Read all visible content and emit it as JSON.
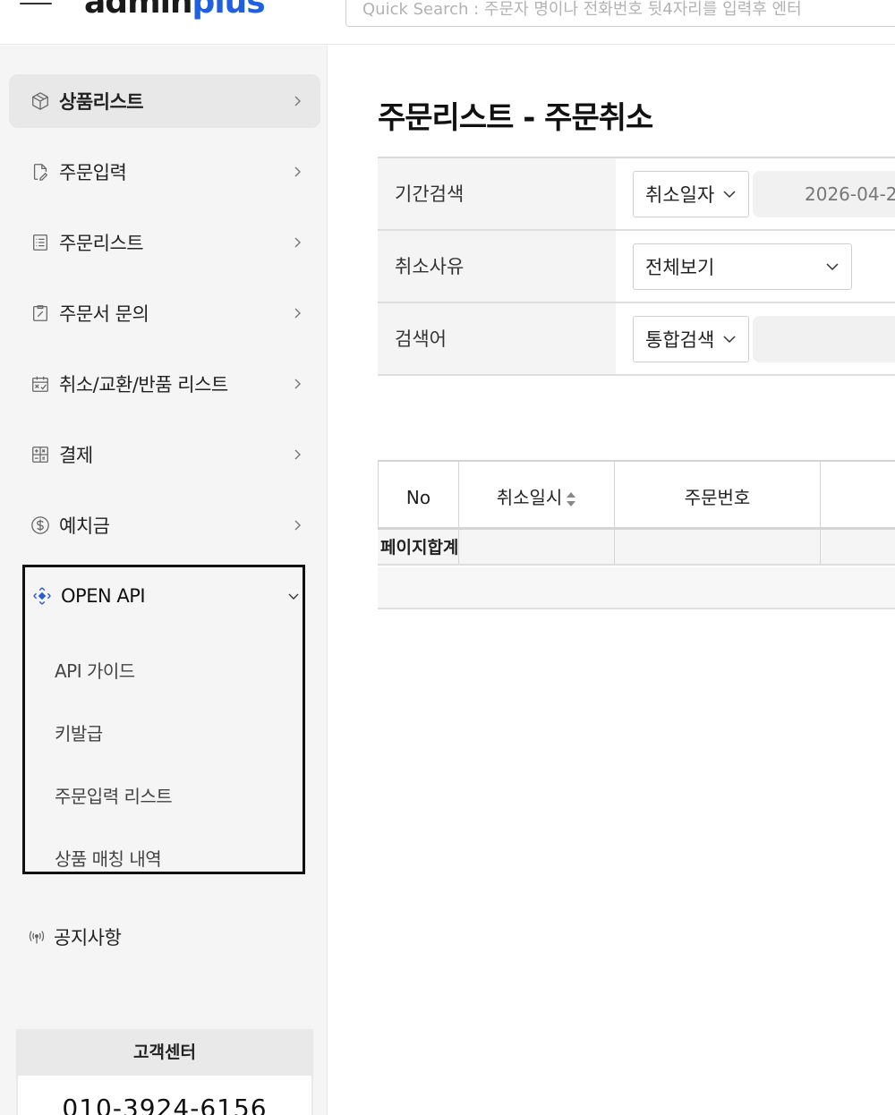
{
  "header": {
    "logo_main": "admin",
    "logo_accent": "plus",
    "search_placeholder": "Quick Search : 주문자 명이나 전화번호 뒷4자리를 입력후 엔터"
  },
  "sidebar": {
    "items": [
      {
        "label": "상품리스트",
        "icon": "box-icon",
        "active": true
      },
      {
        "label": "주문입력",
        "icon": "edit-document-icon"
      },
      {
        "label": "주문리스트",
        "icon": "list-icon"
      },
      {
        "label": "주문서 문의",
        "icon": "clipboard-edit-icon"
      },
      {
        "label": "취소/교환/반품 리스트",
        "icon": "calendar-cancel-icon"
      },
      {
        "label": "결제",
        "icon": "calculator-icon"
      },
      {
        "label": "예치금",
        "icon": "dollar-icon"
      }
    ],
    "open_api": {
      "label": "OPEN API",
      "icon": "api-icon",
      "sub_items": [
        "API 가이드",
        "키발급",
        "주문입력 리스트",
        "상품 매칭 내역"
      ]
    },
    "notice": {
      "label": "공지사항",
      "icon": "broadcast-icon"
    },
    "customer_center": {
      "title": "고객센터",
      "phone": "010-3924-6156"
    }
  },
  "main": {
    "title": "주문리스트 - 주문취소",
    "filters": {
      "period": {
        "label": "기간검색",
        "select": "취소일자",
        "date": "2026-04-2"
      },
      "reason": {
        "label": "취소사유",
        "select": "전체보기"
      },
      "keyword": {
        "label": "검색어",
        "select": "통합검색",
        "value": ""
      }
    },
    "table": {
      "columns": [
        "No",
        "취소일시",
        "주문번호"
      ],
      "summary_label": "페이지합계"
    }
  },
  "colors": {
    "accent": "#1f5fe0",
    "sidebar_bg": "#f5f5f5",
    "active_bg": "#e8e8e8"
  }
}
